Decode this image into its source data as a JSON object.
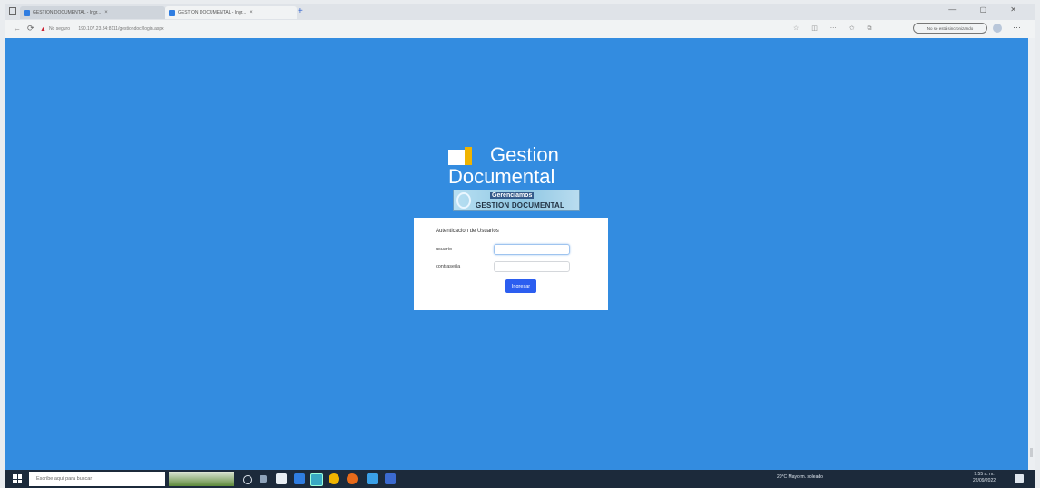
{
  "browser": {
    "tabs": [
      {
        "label": "GESTION DOCUMENTAL - Ingr..."
      },
      {
        "label": "GESTION DOCUMENTAL - Ingr..."
      }
    ],
    "new_tab": "+",
    "window_controls": "—  ▢  ✕",
    "security_label": "No seguro",
    "url": "190.107.23.84:8111/gestiondocl/login.aspx",
    "sync_button": "No se está sincronizando",
    "more": "···"
  },
  "app": {
    "logo_line1": "Gestion",
    "logo_line2": "Documental",
    "banner_top": "Gerenciamos",
    "banner_bottom": "GESTION DOCUMENTAL",
    "card_title": "Autenticacion de Usuarios",
    "user_label": "usuario",
    "password_label": "contraseña",
    "submit_label": "Ingresar",
    "colors": {
      "background": "#338ce0",
      "button": "#2c5ef0",
      "logo_accent": "#f0b400"
    }
  },
  "taskbar": {
    "search_placeholder": "Escribe aquí para buscar",
    "tray_text": "20°C Mayorm. soleado",
    "time": "9:55 a. m.",
    "date": "22/09/2022"
  }
}
